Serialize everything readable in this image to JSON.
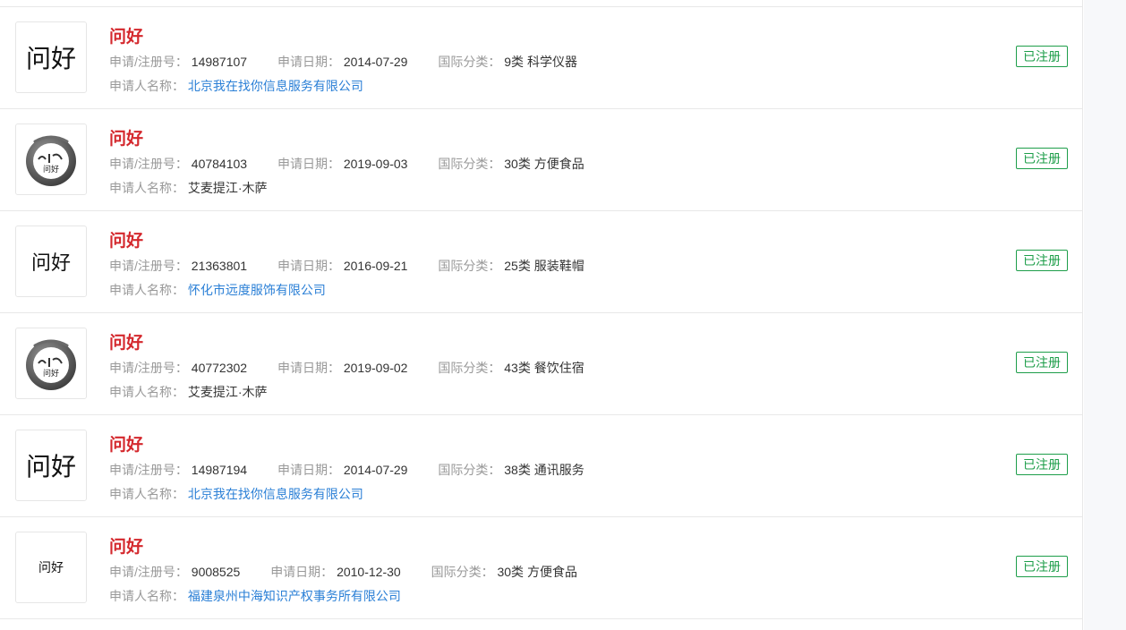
{
  "labels": {
    "reg_no": "申请/注册号：",
    "date": "申请日期：",
    "class": "国际分类：",
    "applicant": "申请人名称："
  },
  "colors": {
    "name": "#d4282d",
    "link": "#2a7fd6",
    "status": "#1e9e4a"
  },
  "items": [
    {
      "logo": "text",
      "logo_text": "问好",
      "logo_size": "lg",
      "name": "问好",
      "reg_no": "14987107",
      "date": "2014-07-29",
      "class": "9类 科学仪器",
      "applicant": "北京我在找你信息服务有限公司",
      "applicant_link": true,
      "status": "已注册"
    },
    {
      "logo": "image",
      "logo_text": "问好",
      "logo_size": "lg",
      "name": "问好",
      "reg_no": "40784103",
      "date": "2019-09-03",
      "class": "30类 方便食品",
      "applicant": "艾麦提江·木萨",
      "applicant_link": false,
      "status": "已注册"
    },
    {
      "logo": "text",
      "logo_text": "问好",
      "logo_size": "md",
      "name": "问好",
      "reg_no": "21363801",
      "date": "2016-09-21",
      "class": "25类 服装鞋帽",
      "applicant": "怀化市远度服饰有限公司",
      "applicant_link": true,
      "status": "已注册"
    },
    {
      "logo": "image",
      "logo_text": "问好",
      "logo_size": "lg",
      "name": "问好",
      "reg_no": "40772302",
      "date": "2019-09-02",
      "class": "43类 餐饮住宿",
      "applicant": "艾麦提江·木萨",
      "applicant_link": false,
      "status": "已注册"
    },
    {
      "logo": "text",
      "logo_text": "问好",
      "logo_size": "lg",
      "name": "问好",
      "reg_no": "14987194",
      "date": "2014-07-29",
      "class": "38类 通讯服务",
      "applicant": "北京我在找你信息服务有限公司",
      "applicant_link": true,
      "status": "已注册"
    },
    {
      "logo": "text",
      "logo_text": "问好",
      "logo_size": "sm",
      "name": "问好",
      "reg_no": "9008525",
      "date": "2010-12-30",
      "class": "30类 方便食品",
      "applicant": "福建泉州中海知识产权事务所有限公司",
      "applicant_link": true,
      "status": "已注册"
    }
  ]
}
